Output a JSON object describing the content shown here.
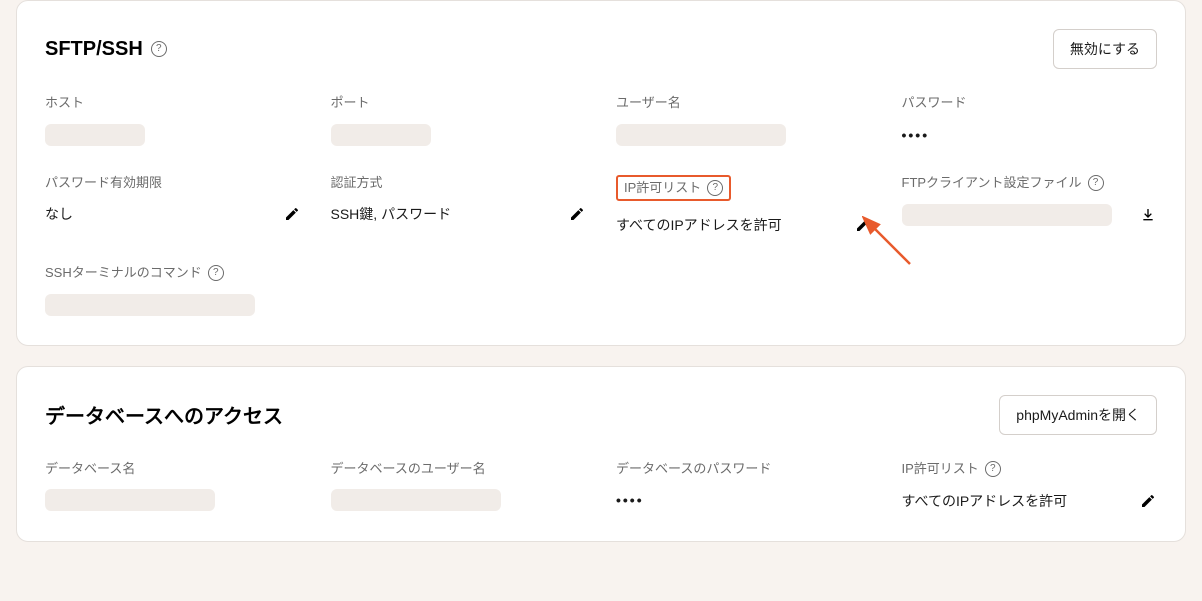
{
  "sftp": {
    "title": "SFTP/SSH",
    "disableButton": "無効にする",
    "host": {
      "label": "ホスト"
    },
    "port": {
      "label": "ポート"
    },
    "username": {
      "label": "ユーザー名"
    },
    "password": {
      "label": "パスワード",
      "value": "••••"
    },
    "passwordExpiry": {
      "label": "パスワード有効期限",
      "value": "なし"
    },
    "authMethod": {
      "label": "認証方式",
      "value": "SSH鍵, パスワード"
    },
    "ipAllow": {
      "label": "IP許可リスト",
      "value": "すべてのIPアドレスを許可"
    },
    "ftpClientFile": {
      "label": "FTPクライアント設定ファイル"
    },
    "sshTerminal": {
      "label": "SSHターミナルのコマンド"
    }
  },
  "db": {
    "title": "データベースへのアクセス",
    "openButton": "phpMyAdminを開く",
    "dbName": {
      "label": "データベース名"
    },
    "dbUser": {
      "label": "データベースのユーザー名"
    },
    "dbPassword": {
      "label": "データベースのパスワード",
      "value": "••••"
    },
    "ipAllow": {
      "label": "IP許可リスト",
      "value": "すべてのIPアドレスを許可"
    }
  }
}
